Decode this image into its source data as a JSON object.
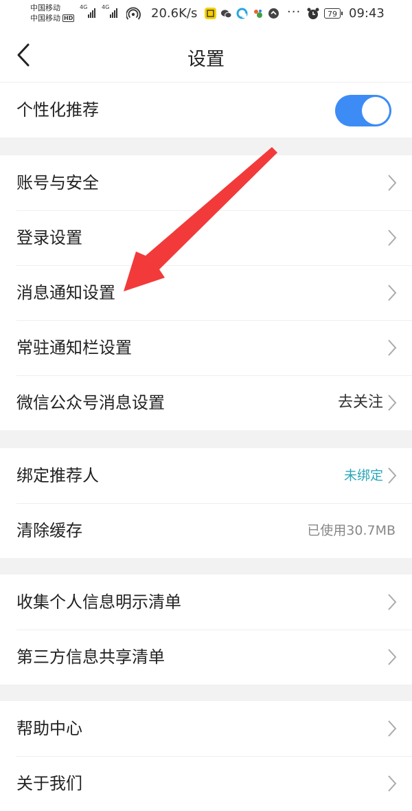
{
  "status_bar": {
    "carrier_1": "中国移动",
    "carrier_2": "中国移动",
    "hd_badge": "HD",
    "net_1": "4G",
    "net_2": "4G",
    "speed": "20.6K/s",
    "battery": "79",
    "time": "09:43",
    "more": "···"
  },
  "nav": {
    "title": "设置"
  },
  "groups": {
    "personalization": {
      "label": "个性化推荐",
      "toggle_on": true
    },
    "account": [
      {
        "label": "账号与安全"
      },
      {
        "label": "登录设置"
      },
      {
        "label": "消息通知设置"
      },
      {
        "label": "常驻通知栏设置"
      },
      {
        "label": "微信公众号消息设置",
        "value": "去关注"
      }
    ],
    "misc": [
      {
        "label": "绑定推荐人",
        "value": "未绑定"
      },
      {
        "label": "清除缓存",
        "value": "已使用30.7MB"
      }
    ],
    "privacy": [
      {
        "label": "收集个人信息明示清单"
      },
      {
        "label": "第三方信息共享清单"
      }
    ],
    "about": [
      {
        "label": "帮助中心"
      },
      {
        "label": "关于我们"
      }
    ]
  },
  "colors": {
    "toggle_on": "#3d8cf5",
    "accent_value": "#2aa6b8",
    "annotation_arrow": "#f23a3a"
  }
}
